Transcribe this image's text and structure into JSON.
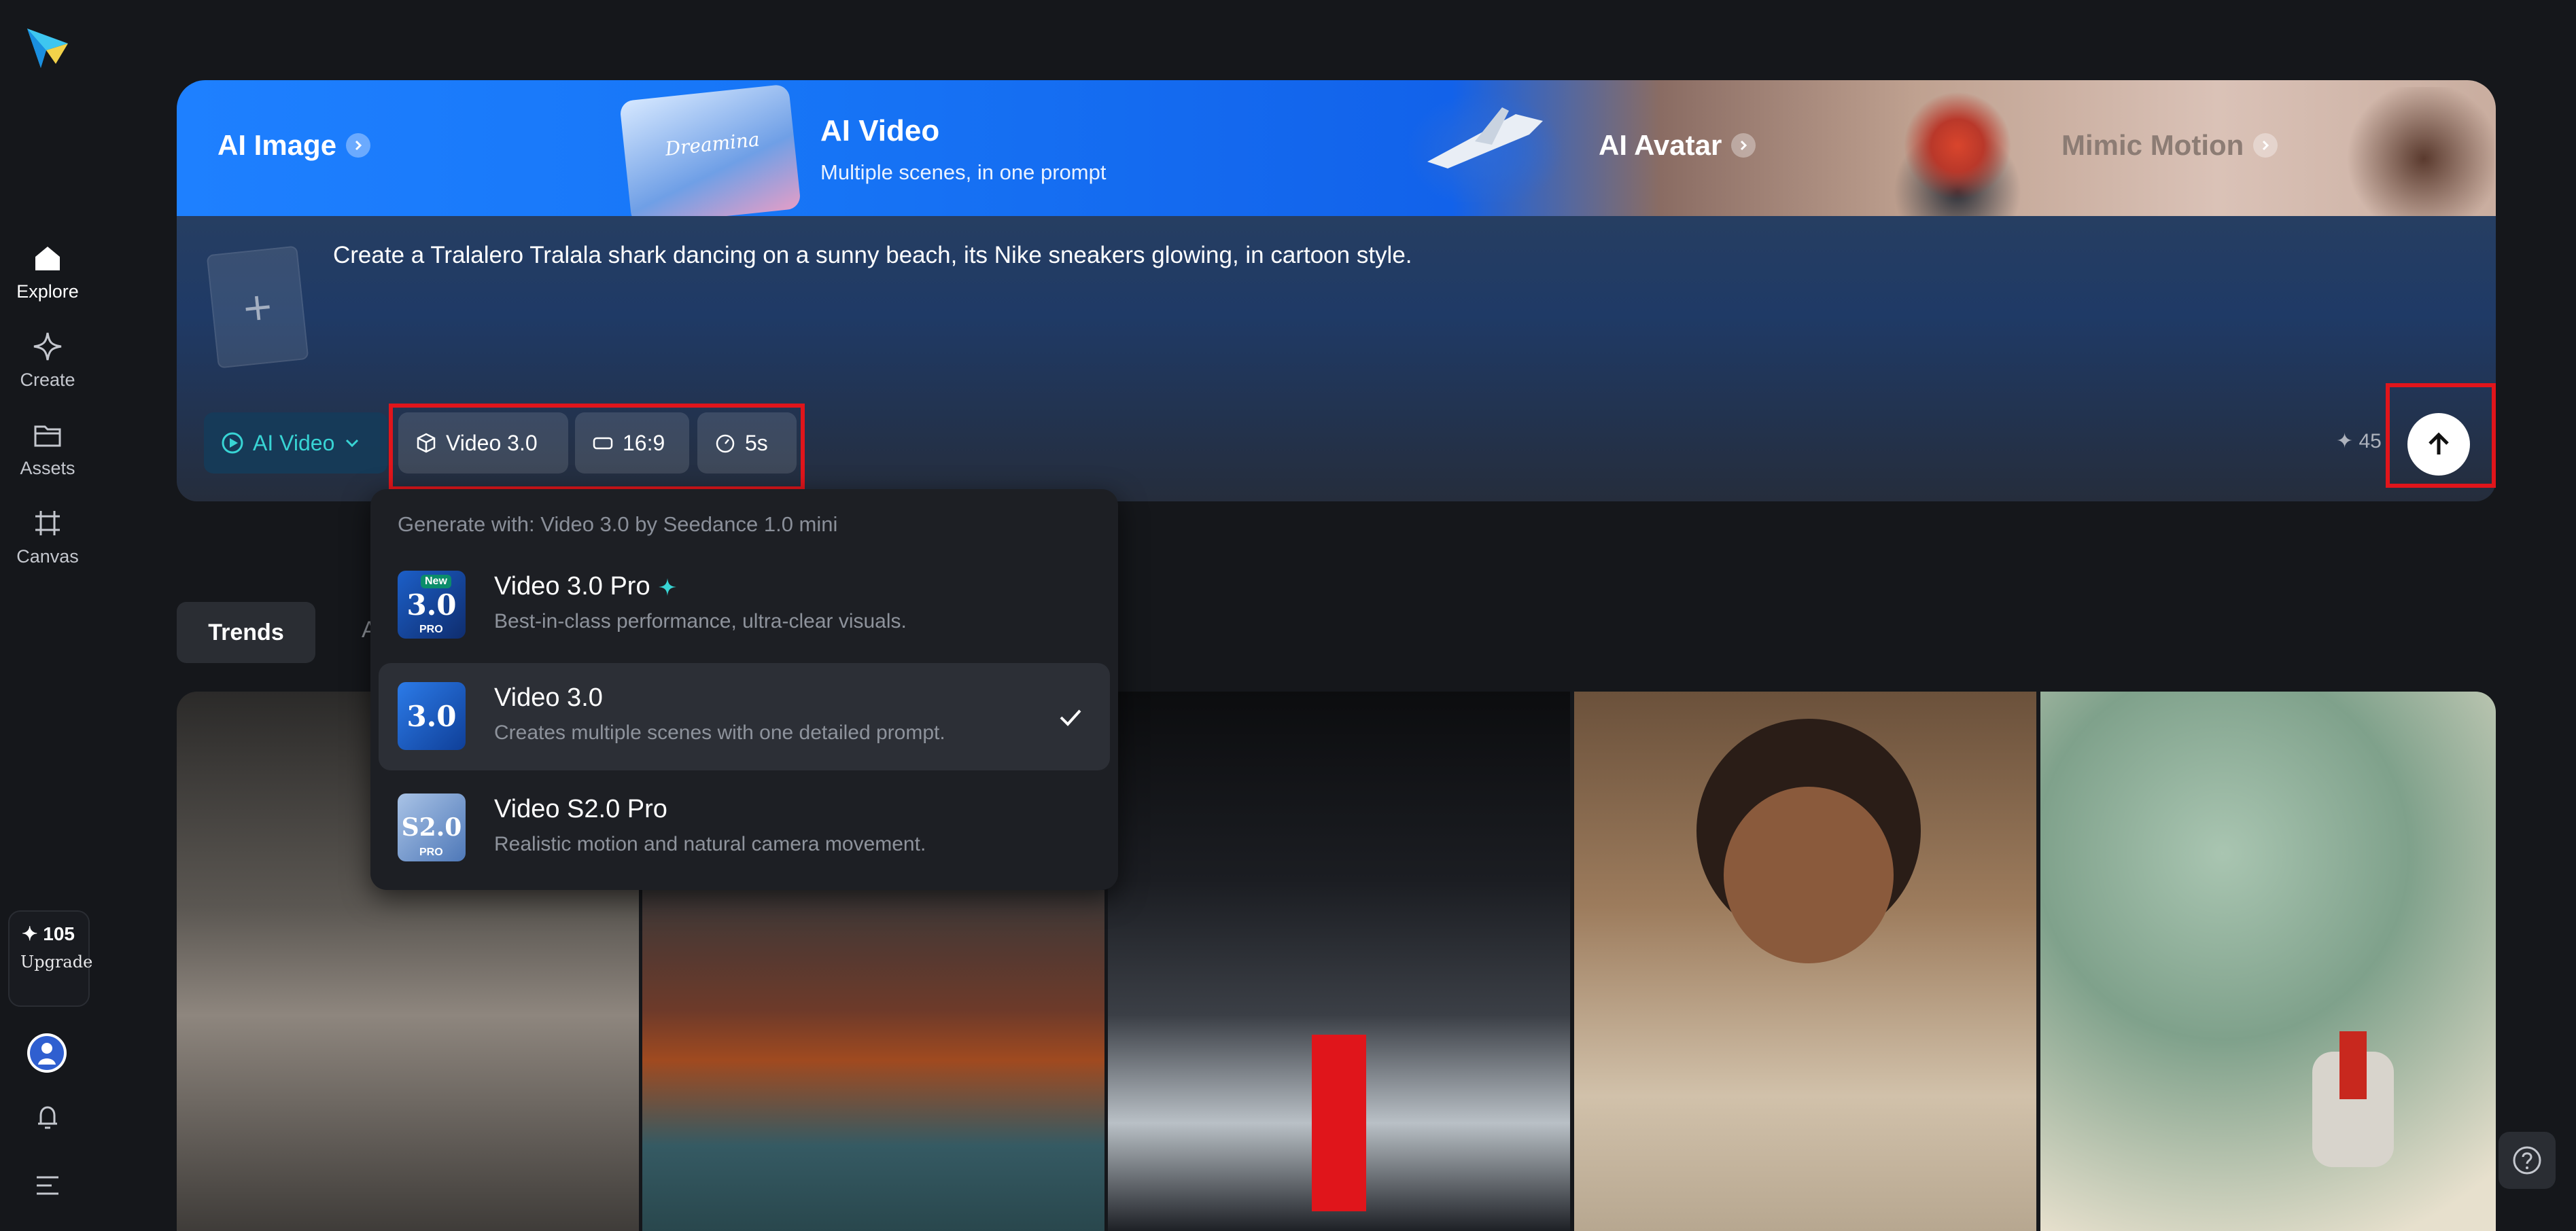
{
  "sidebar": {
    "nav": [
      {
        "label": "Explore",
        "icon": "home-icon",
        "active": true
      },
      {
        "label": "Create",
        "icon": "sparkle-icon"
      },
      {
        "label": "Assets",
        "icon": "folder-icon"
      },
      {
        "label": "Canvas",
        "icon": "grid-crop-icon"
      }
    ],
    "credits": "✦ 105",
    "upgrade": "Upgrade"
  },
  "banner": {
    "tabs": [
      {
        "label": "AI Image"
      },
      {
        "label": "AI Video",
        "subtitle": "Multiple scenes, in one prompt",
        "active": true
      },
      {
        "label": "AI Avatar"
      },
      {
        "label": "Mimic Motion"
      }
    ],
    "thumb_text": "Dreamina"
  },
  "prompt": {
    "text": "Create a Tralalero Tralala shark dancing on a sunny beach, its Nike sneakers glowing, in cartoon style.",
    "mode": "AI Video",
    "model": "Video 3.0",
    "ratio": "16:9",
    "duration": "5s",
    "cost": "✦ 45"
  },
  "dropdown": {
    "header": "Generate with: Video 3.0 by Seedance 1.0 mini",
    "items": [
      {
        "title": "Video 3.0 Pro",
        "desc": "Best-in-class performance, ultra-clear visuals.",
        "badge": "New",
        "icon_text": "3.0",
        "icon_sub": "PRO",
        "selected": false
      },
      {
        "title": "Video 3.0",
        "desc": "Creates multiple scenes with one detailed prompt.",
        "icon_text": "3.0",
        "selected": true
      },
      {
        "title": "Video S2.0 Pro",
        "desc": "Realistic motion and natural camera movement.",
        "icon_text": "S2.0",
        "icon_sub": "PRO",
        "selected": false
      }
    ]
  },
  "tabs_row": {
    "active": "Trends",
    "second": "A"
  },
  "colors": {
    "accent": "#38d4d4",
    "highlight": "#e0151b",
    "background": "#15171b"
  }
}
